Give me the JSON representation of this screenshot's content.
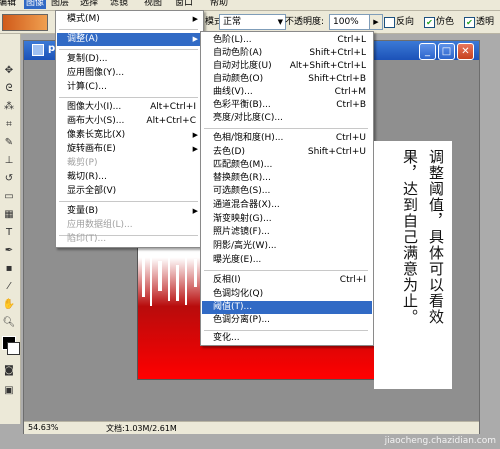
{
  "menubar": {
    "items": [
      "编辑",
      "图像",
      "图层",
      "选择",
      "滤镜",
      "视图",
      "窗口",
      "帮助"
    ],
    "active": "图像"
  },
  "options": {
    "mode_label": "模式:",
    "mode_value": "正常",
    "opacity_label": "不透明度:",
    "opacity_value": "100%",
    "reverse_label": "反向",
    "dither_label": "仿色",
    "transparency_label": "透明"
  },
  "doc": {
    "title": "p",
    "zoom": "54.63%",
    "status": "文档:1.03M/2.61M"
  },
  "image_menu": {
    "items": [
      {
        "label": "模式(M)",
        "shortcut": "",
        "submenu": true,
        "disabled": false,
        "highlight": false
      },
      {
        "label": "调整(A)",
        "shortcut": "",
        "submenu": true,
        "disabled": false,
        "highlight": true
      },
      {
        "label": "复制(D)...",
        "shortcut": "",
        "submenu": false,
        "disabled": false,
        "highlight": false
      },
      {
        "label": "应用图像(Y)...",
        "shortcut": "",
        "submenu": false,
        "disabled": false,
        "highlight": false
      },
      {
        "label": "计算(C)...",
        "shortcut": "",
        "submenu": false,
        "disabled": false,
        "highlight": false
      },
      {
        "label": "图像大小(I)...",
        "shortcut": "Alt+Ctrl+I",
        "submenu": false,
        "disabled": false,
        "highlight": false
      },
      {
        "label": "画布大小(S)...",
        "shortcut": "Alt+Ctrl+C",
        "submenu": false,
        "disabled": false,
        "highlight": false
      },
      {
        "label": "像素长宽比(X)",
        "shortcut": "",
        "submenu": true,
        "disabled": false,
        "highlight": false
      },
      {
        "label": "旋转画布(E)",
        "shortcut": "",
        "submenu": true,
        "disabled": false,
        "highlight": false
      },
      {
        "label": "裁剪(P)",
        "shortcut": "",
        "submenu": false,
        "disabled": true,
        "highlight": false
      },
      {
        "label": "裁切(R)...",
        "shortcut": "",
        "submenu": false,
        "disabled": false,
        "highlight": false
      },
      {
        "label": "显示全部(V)",
        "shortcut": "",
        "submenu": false,
        "disabled": false,
        "highlight": false
      },
      {
        "label": "变量(B)",
        "shortcut": "",
        "submenu": true,
        "disabled": false,
        "highlight": false
      },
      {
        "label": "应用数据组(L)...",
        "shortcut": "",
        "submenu": false,
        "disabled": true,
        "highlight": false
      },
      {
        "label": "陷印(T)...",
        "shortcut": "",
        "submenu": false,
        "disabled": true,
        "highlight": false
      }
    ]
  },
  "adjust_menu": {
    "items": [
      {
        "label": "色阶(L)...",
        "shortcut": "Ctrl+L",
        "highlight": false
      },
      {
        "label": "自动色阶(A)",
        "shortcut": "Shift+Ctrl+L",
        "highlight": false
      },
      {
        "label": "自动对比度(U)",
        "shortcut": "Alt+Shift+Ctrl+L",
        "highlight": false
      },
      {
        "label": "自动颜色(O)",
        "shortcut": "Shift+Ctrl+B",
        "highlight": false
      },
      {
        "label": "曲线(V)...",
        "shortcut": "Ctrl+M",
        "highlight": false
      },
      {
        "label": "色彩平衡(B)...",
        "shortcut": "Ctrl+B",
        "highlight": false
      },
      {
        "label": "亮度/对比度(C)...",
        "shortcut": "",
        "highlight": false
      },
      {
        "label": "色相/饱和度(H)...",
        "shortcut": "Ctrl+U",
        "highlight": false
      },
      {
        "label": "去色(D)",
        "shortcut": "Shift+Ctrl+U",
        "highlight": false
      },
      {
        "label": "匹配颜色(M)...",
        "shortcut": "",
        "highlight": false
      },
      {
        "label": "替换颜色(R)...",
        "shortcut": "",
        "highlight": false
      },
      {
        "label": "可选颜色(S)...",
        "shortcut": "",
        "highlight": false
      },
      {
        "label": "通道混合器(X)...",
        "shortcut": "",
        "highlight": false
      },
      {
        "label": "渐变映射(G)...",
        "shortcut": "",
        "highlight": false
      },
      {
        "label": "照片滤镜(F)...",
        "shortcut": "",
        "highlight": false
      },
      {
        "label": "阴影/高光(W)...",
        "shortcut": "",
        "highlight": false
      },
      {
        "label": "曝光度(E)...",
        "shortcut": "",
        "highlight": false
      },
      {
        "label": "反相(I)",
        "shortcut": "Ctrl+I",
        "highlight": false
      },
      {
        "label": "色调均化(Q)",
        "shortcut": "",
        "highlight": false
      },
      {
        "label": "阈值(T)...",
        "shortcut": "",
        "highlight": true
      },
      {
        "label": "色调分离(P)...",
        "shortcut": "",
        "highlight": false
      },
      {
        "label": "变化...",
        "shortcut": "",
        "highlight": false
      }
    ]
  },
  "note": {
    "col1": "调整阈值，具体可以看效",
    "col2": "果，达到自己满意为止。"
  },
  "watermark": "jiaocheng.chazidian.com",
  "colors": {
    "highlight": "#316ac5",
    "titlebar": "#1c52b8",
    "canvas_red": "#ff0000"
  }
}
